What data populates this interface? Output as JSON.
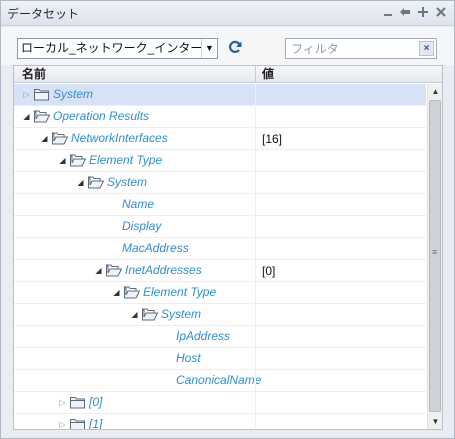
{
  "panel": {
    "title": "データセット",
    "title_icons": [
      "minimize-icon",
      "restore-icon",
      "maximize-icon",
      "close-icon"
    ]
  },
  "toolbar": {
    "select_value": "ローカル_ネットワーク_インターフェ",
    "refresh_icon": "refresh-icon",
    "filter_placeholder": "フィルタ",
    "filter_value": "",
    "clear_label": "×"
  },
  "grid": {
    "columns": {
      "name": "名前",
      "value": "値"
    },
    "rows": [
      {
        "label": "System",
        "value": "",
        "level": 0,
        "expander": "collapsed",
        "folder": "closed",
        "selected": true
      },
      {
        "label": "Operation Results",
        "value": "",
        "level": 0,
        "expander": "expanded",
        "folder": "open"
      },
      {
        "label": "NetworkInterfaces",
        "value": "[16]",
        "level": 1,
        "expander": "expanded",
        "folder": "open"
      },
      {
        "label": "Element Type",
        "value": "",
        "level": 2,
        "expander": "expanded",
        "folder": "open"
      },
      {
        "label": "System",
        "value": "",
        "level": 3,
        "expander": "expanded",
        "folder": "open"
      },
      {
        "label": "Name",
        "value": "",
        "level": 4,
        "expander": "none",
        "folder": "none"
      },
      {
        "label": "Display",
        "value": "",
        "level": 4,
        "expander": "none",
        "folder": "none"
      },
      {
        "label": "MacAddress",
        "value": "",
        "level": 4,
        "expander": "none",
        "folder": "none"
      },
      {
        "label": "InetAddresses",
        "value": "[0]",
        "level": 4,
        "expander": "expanded",
        "folder": "open"
      },
      {
        "label": "Element Type",
        "value": "",
        "level": 5,
        "expander": "expanded",
        "folder": "open"
      },
      {
        "label": "System",
        "value": "",
        "level": 6,
        "expander": "expanded",
        "folder": "open"
      },
      {
        "label": "IpAddress",
        "value": "",
        "level": 7,
        "expander": "none",
        "folder": "none"
      },
      {
        "label": "Host",
        "value": "",
        "level": 7,
        "expander": "none",
        "folder": "none"
      },
      {
        "label": "CanonicalName",
        "value": "",
        "level": 7,
        "expander": "none",
        "folder": "none"
      },
      {
        "label": "[0]",
        "value": "",
        "level": 2,
        "expander": "collapsed",
        "folder": "closed"
      },
      {
        "label": "[1]",
        "value": "",
        "level": 2,
        "expander": "collapsed",
        "folder": "closed"
      }
    ]
  },
  "scrollbar": {
    "up_icon": "scroll-up-icon",
    "down_icon": "scroll-down-icon"
  },
  "colors": {
    "label": "#2e8fcf",
    "selected_row": "#d7e2f7",
    "header_bg": "#e4e8ed"
  }
}
